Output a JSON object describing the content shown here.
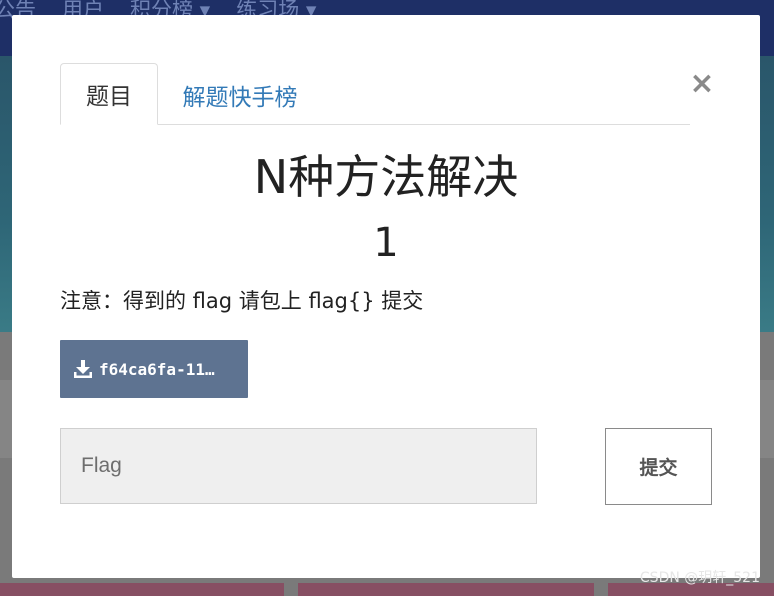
{
  "background": {
    "nav_items": [
      "公告",
      "用户",
      "积分榜 ▾",
      "练习场 ▾"
    ]
  },
  "modal": {
    "tabs": [
      {
        "label": "题目",
        "active": true
      },
      {
        "label": "解题快手榜",
        "active": false
      }
    ],
    "close_label": "×",
    "title": "N种方法解决",
    "score": "1",
    "description": "注意：得到的 flag 请包上 flag{} 提交",
    "download": {
      "icon": "download-icon",
      "label": "f64ca6fa-11…"
    },
    "flag_input": {
      "placeholder": "Flag",
      "value": ""
    },
    "submit_label": "提交"
  },
  "watermark": "CSDN @玥轩_521",
  "colors": {
    "navbar": "#1e2f66",
    "link": "#337ab7",
    "download_button": "#5e7391",
    "input_bg": "#efefef"
  }
}
